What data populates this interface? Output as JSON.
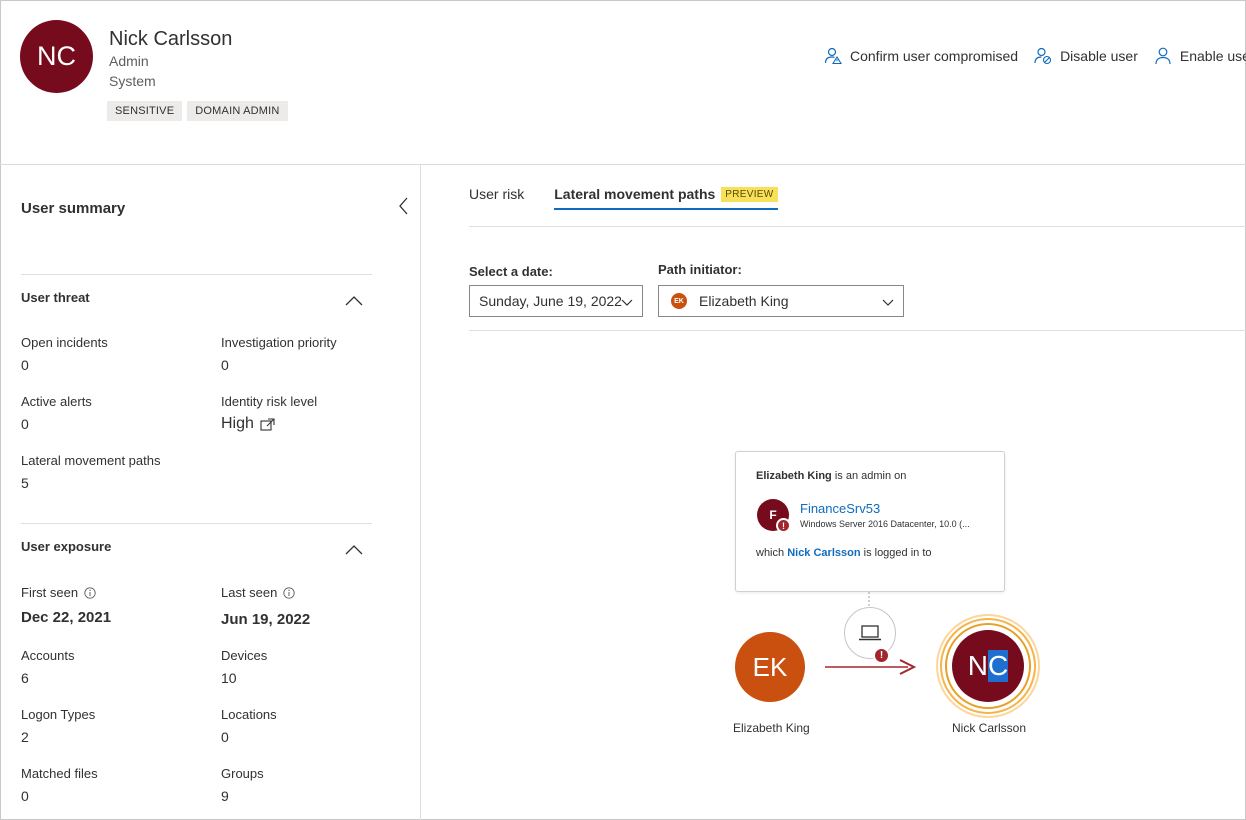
{
  "header": {
    "avatar_initials": "NC",
    "name": "Nick Carlsson",
    "role": "Admin",
    "department": "System",
    "tags": [
      "SENSITIVE",
      "DOMAIN ADMIN"
    ],
    "actions": {
      "confirm": "Confirm user compromised",
      "disable": "Disable user",
      "enable": "Enable user"
    }
  },
  "summary": {
    "title": "User summary",
    "threat": {
      "title": "User threat",
      "open_incidents_label": "Open incidents",
      "open_incidents": "0",
      "investigation_priority_label": "Investigation priority",
      "investigation_priority": "0",
      "active_alerts_label": "Active alerts",
      "active_alerts": "0",
      "identity_risk_label": "Identity risk level",
      "identity_risk": "High",
      "lateral_paths_label": "Lateral movement paths",
      "lateral_paths": "5"
    },
    "exposure": {
      "title": "User exposure",
      "first_seen_label": "First seen",
      "first_seen": "Dec 22, 2021",
      "last_seen_label": "Last seen",
      "last_seen": "Jun 19, 2022",
      "accounts_label": "Accounts",
      "accounts": "6",
      "devices_label": "Devices",
      "devices": "10",
      "logon_types_label": "Logon Types",
      "logon_types": "2",
      "locations_label": "Locations",
      "locations": "0",
      "matched_files_label": "Matched files",
      "matched_files": "0",
      "groups_label": "Groups",
      "groups": "9"
    }
  },
  "tabs": {
    "user_risk": "User risk",
    "lateral": "Lateral movement paths",
    "preview_badge": "PREVIEW"
  },
  "filters": {
    "date_label": "Select a date:",
    "date_value": "Sunday, June 19, 2022",
    "initiator_label": "Path initiator:",
    "initiator_initials": "EK",
    "initiator_value": "Elizabeth King"
  },
  "graph": {
    "card": {
      "admin_name": "Elizabeth King",
      "admin_text": " is an admin on",
      "server_initial": "F",
      "server_name": "FinanceSrv53",
      "server_os": "Windows Server 2016 Datacenter, 10.0 (...",
      "logged_prefix": "which ",
      "logged_user": "Nick Carlsson",
      "logged_suffix": " is logged in to"
    },
    "source": {
      "initials": "EK",
      "name": "Elizabeth King"
    },
    "target": {
      "initials_a": "N",
      "initials_b": "C",
      "name": "Nick Carlsson"
    },
    "alert_glyph": "!"
  },
  "colors": {
    "accent": "#0f6cbd",
    "dark_red": "#750b1c",
    "orange": "#ca5010",
    "arrow": "#a4262c"
  }
}
